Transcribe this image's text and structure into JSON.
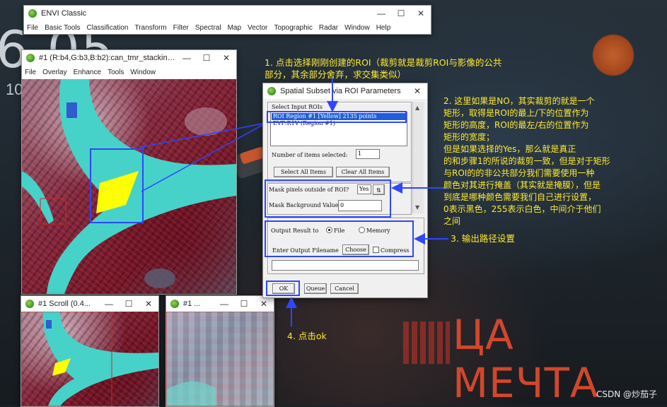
{
  "background": {
    "top_left_digits": "6 05",
    "left_digits": "10",
    "cyrillic_text": "ЦА МЕЧТА"
  },
  "envi_main": {
    "title": "ENVI Classic",
    "menu": [
      "File",
      "Basic Tools",
      "Classification",
      "Transform",
      "Filter",
      "Spectral",
      "Map",
      "Vector",
      "Topographic",
      "Radar",
      "Window",
      "Help"
    ]
  },
  "image_window": {
    "title": "#1 (R:b4,G:b3,B:b2):can_tmr_stacking...",
    "menu": [
      "File",
      "Overlay",
      "Enhance",
      "Tools",
      "Window"
    ]
  },
  "scroll_window": {
    "title": "#1 Scroll (0.4..."
  },
  "zoom_window": {
    "title": "#1 ..."
  },
  "window_controls": {
    "minimize": "—",
    "maximize": "☐",
    "close": "✕"
  },
  "dialog": {
    "title": "Spatial Subset via ROI Parameters",
    "select_label": "Select Input ROIs",
    "roi_items": [
      "ROI Region #1 [Yellow] 2135 points",
      "EVF:R1V (Region #1)"
    ],
    "selected_count_label": "Number of items selected:",
    "selected_count_value": "1",
    "select_all": "Select All Items",
    "clear_all": "Clear All Items",
    "mask_label": "Mask pixels outside of ROI?",
    "mask_value": "Yes",
    "mask_toggle": "⇅",
    "mask_bg_label": "Mask Background Value",
    "mask_bg_value": "0",
    "output_label": "Output Result to",
    "file_option": "File",
    "memory_option": "Memory",
    "filename_label": "Enter Output Filename",
    "choose": "Choose",
    "compress": "Compress",
    "filename_value": "",
    "ok": "OK",
    "queue": "Queue",
    "cancel": "Cancel"
  },
  "annotations": {
    "step1": [
      "1. 点击选择刚刚创建的ROI（裁剪就是裁剪ROI与影像的公共",
      "部分，其余部分舍弃，求交集类似）"
    ],
    "step2": [
      "2. 这里如果是NO，其实裁剪的就是一个",
      "矩形，取得是ROI的最上/下的位置作为",
      "矩形的高度，ROI的最左/右的位置作为",
      "矩形的宽度；",
      "但是如果选择的Yes，那么就是真正",
      "的和步骤1的所说的裁剪一致，但是对于矩形",
      "与ROI的的非公共部分我们需要使用一种",
      "颜色对其进行掩盖（其实就是掩膜），但是",
      "到底是哪种颜色需要我们自己进行设置，",
      "0表示黑色，255表示白色，中间介于他们",
      "之间"
    ],
    "step3": "3. 输出路径设置",
    "step4": "4. 点击ok"
  },
  "watermark": "CSDN @炒茄子",
  "colors": {
    "annotation": "#ffeb2e",
    "highlight_box": "#2f46ff",
    "roi_fill": "#ffff00",
    "river": "#3fd0c8"
  }
}
